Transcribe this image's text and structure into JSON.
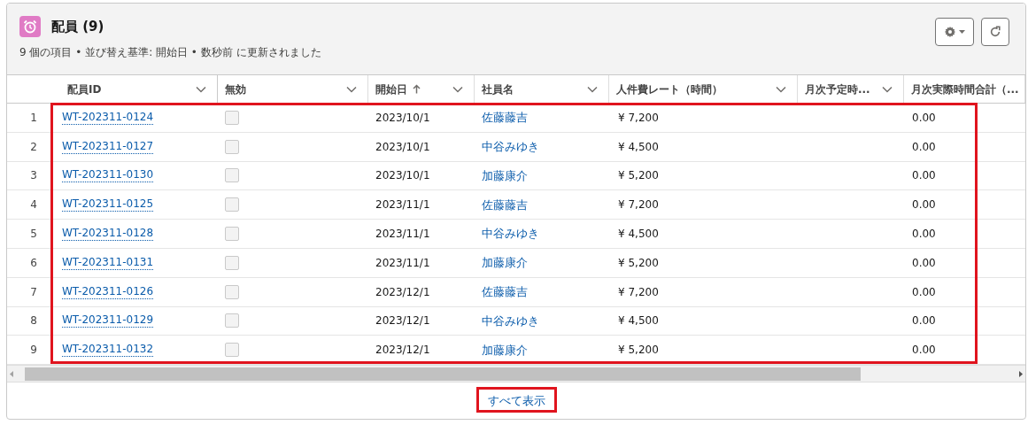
{
  "card": {
    "title": "配員 (9)",
    "subtitle": "9 個の項目 • 並び替え基準: 開始日 • 数秒前 に更新されました"
  },
  "columns": [
    {
      "label": "配員ID",
      "sorted": false,
      "menu": true
    },
    {
      "label": "無効",
      "sorted": false,
      "menu": true
    },
    {
      "label": "開始日",
      "sorted": true,
      "menu": true
    },
    {
      "label": "社員名",
      "sorted": false,
      "menu": true
    },
    {
      "label": "人件費レート（時間）",
      "sorted": false,
      "menu": true
    },
    {
      "label": "月次予定時...",
      "sorted": false,
      "menu": true
    },
    {
      "label": "月次実際時間合計（..."
    }
  ],
  "rows": [
    {
      "number": "1",
      "id": "WT-202311-0124",
      "inactive": false,
      "start_date": "2023/10/1",
      "employee": "佐藤藤吉",
      "rate": "¥ 7,200",
      "monthly_actual": "0.00"
    },
    {
      "number": "2",
      "id": "WT-202311-0127",
      "inactive": false,
      "start_date": "2023/10/1",
      "employee": "中谷みゆき",
      "rate": "¥ 4,500",
      "monthly_actual": "0.00"
    },
    {
      "number": "3",
      "id": "WT-202311-0130",
      "inactive": false,
      "start_date": "2023/10/1",
      "employee": "加藤康介",
      "rate": "¥ 5,200",
      "monthly_actual": "0.00"
    },
    {
      "number": "4",
      "id": "WT-202311-0125",
      "inactive": false,
      "start_date": "2023/11/1",
      "employee": "佐藤藤吉",
      "rate": "¥ 7,200",
      "monthly_actual": "0.00"
    },
    {
      "number": "5",
      "id": "WT-202311-0128",
      "inactive": false,
      "start_date": "2023/11/1",
      "employee": "中谷みゆき",
      "rate": "¥ 4,500",
      "monthly_actual": "0.00"
    },
    {
      "number": "6",
      "id": "WT-202311-0131",
      "inactive": false,
      "start_date": "2023/11/1",
      "employee": "加藤康介",
      "rate": "¥ 5,200",
      "monthly_actual": "0.00"
    },
    {
      "number": "7",
      "id": "WT-202311-0126",
      "inactive": false,
      "start_date": "2023/12/1",
      "employee": "佐藤藤吉",
      "rate": "¥ 7,200",
      "monthly_actual": "0.00"
    },
    {
      "number": "8",
      "id": "WT-202311-0129",
      "inactive": false,
      "start_date": "2023/12/1",
      "employee": "中谷みゆき",
      "rate": "¥ 4,500",
      "monthly_actual": "0.00"
    },
    {
      "number": "9",
      "id": "WT-202311-0132",
      "inactive": false,
      "start_date": "2023/12/1",
      "employee": "加藤康介",
      "rate": "¥ 5,200",
      "monthly_actual": "0.00"
    }
  ],
  "footer": {
    "link": "すべて表示"
  }
}
